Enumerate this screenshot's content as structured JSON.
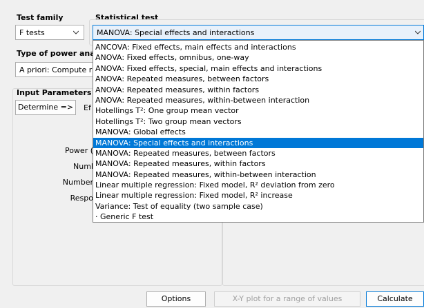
{
  "test_family": {
    "label": "Test family",
    "value": "F tests"
  },
  "statistical_test": {
    "label": "Statistical test",
    "value": "MANOVA: Special effects and interactions",
    "options": [
      "ANCOVA: Fixed effects, main effects and interactions",
      "ANOVA: Fixed effects, omnibus, one-way",
      "ANOVA: Fixed effects, special, main effects and interactions",
      "ANOVA: Repeated measures, between factors",
      "ANOVA: Repeated measures, within factors",
      "ANOVA: Repeated measures, within-between interaction",
      "Hotellings T²: One group mean vector",
      "Hotellings T²: Two group mean vectors",
      "MANOVA: Global effects",
      "MANOVA: Special effects and interactions",
      "MANOVA: Repeated measures, between factors",
      "MANOVA: Repeated measures, within factors",
      "MANOVA: Repeated measures, within-between interaction",
      "Linear multiple regression: Fixed model, R² deviation from zero",
      "Linear multiple regression: Fixed model, R² increase",
      "Variance: Test of equality (two sample case)",
      "· Generic F test"
    ],
    "selected_index": 9
  },
  "power_analysis": {
    "label": "Type of power analy",
    "value": "A priori: Compute r"
  },
  "input_parameters": {
    "label": "Input Parameters",
    "determine_button": "Determine =>",
    "effect_label_fragment": "Ef",
    "row_labels": [
      "Power (",
      "Numl",
      "Number",
      "Respo"
    ]
  },
  "bottom_buttons": {
    "options": "Options",
    "xy_plot": "X-Y plot for a range of values",
    "calculate": "Calculate"
  },
  "colors": {
    "accent": "#0078d7",
    "background": "#f0f0f0"
  }
}
